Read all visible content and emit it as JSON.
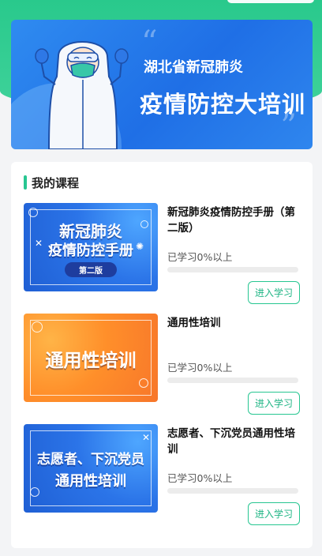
{
  "banner": {
    "subtitle": "湖北省新冠肺炎",
    "title": "疫情防控大培训",
    "quote_open": "“",
    "quote_close": "”"
  },
  "section": {
    "title": "我的课程"
  },
  "courses": [
    {
      "title": "新冠肺炎疫情防控手册（第二版）",
      "progress_text": "已学习0%以上",
      "progress": 0,
      "button": "进入学习",
      "thumb_line1": "新冠肺炎",
      "thumb_line2": "疫情防控手册",
      "thumb_badge": "第二版",
      "thumb_color": "blue"
    },
    {
      "title": "通用性培训",
      "progress_text": "已学习0%以上",
      "progress": 0,
      "button": "进入学习",
      "thumb_line1": "通用性培训",
      "thumb_color": "orange"
    },
    {
      "title": "志愿者、下沉党员通用性培训",
      "progress_text": "已学习0%以上",
      "progress": 0,
      "button": "进入学习",
      "thumb_line1": "志愿者、下沉党员",
      "thumb_line2": "通用性培训",
      "thumb_color": "blue"
    }
  ],
  "colors": {
    "accent": "#27c691",
    "banner": "#2f86ee",
    "header": "#29c98c"
  }
}
